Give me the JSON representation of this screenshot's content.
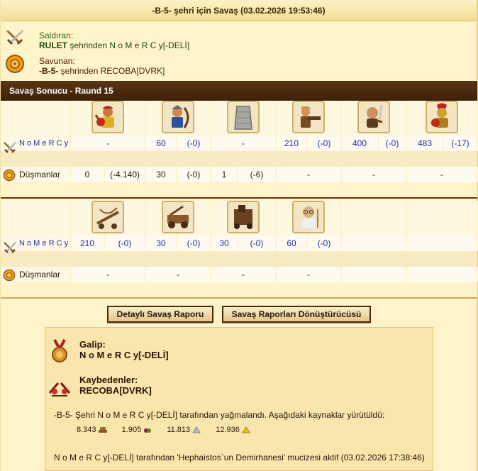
{
  "header": {
    "title": "-B-5- şehri için Savaş (03.02.2026 19:53:46)"
  },
  "attacker": {
    "role": "Saldıran:",
    "player": "RULET",
    "middle": " şehrinden ",
    "city": "N o M e R C y[-DELİ]"
  },
  "defender": {
    "role": "Savunan:",
    "city": "-B-5-",
    "middle": " şehrinden ",
    "player": "RECOBA[DVRK]"
  },
  "result_bar": {
    "title": "Savaş Sonucu - Raund 15"
  },
  "table1": {
    "attacker_label": "N o M e R C y",
    "enemy_label": "Düşmanlar",
    "units": [
      {
        "icon": "ram-unit-icon",
        "atk": "-",
        "atk_delta": "",
        "def": "0",
        "def_delta": "(-4.140)"
      },
      {
        "icon": "archer-unit-icon",
        "atk": "60",
        "atk_delta": "(-0)",
        "def": "30",
        "def_delta": "(-0)"
      },
      {
        "icon": "wall-unit-icon",
        "atk": "-",
        "atk_delta": "",
        "def": "1",
        "def_delta": "(-6)"
      },
      {
        "icon": "gunner-unit-icon",
        "atk": "210",
        "atk_delta": "(-0)",
        "def": "-",
        "def_delta": ""
      },
      {
        "icon": "swordsman-unit-icon",
        "atk": "400",
        "atk_delta": "(-0)",
        "def": "-",
        "def_delta": ""
      },
      {
        "icon": "spartan-unit-icon",
        "atk": "483",
        "atk_delta": "(-17)",
        "def": "-",
        "def_delta": ""
      }
    ]
  },
  "table2": {
    "attacker_label": "N o M e R C y",
    "enemy_label": "Düşmanlar",
    "units": [
      {
        "icon": "ballista-unit-icon",
        "atk": "210",
        "atk_delta": "(-0)",
        "def": "-",
        "def_delta": ""
      },
      {
        "icon": "catapult-unit-icon",
        "atk": "30",
        "atk_delta": "(-0)",
        "def": "-",
        "def_delta": ""
      },
      {
        "icon": "mortar-unit-icon",
        "atk": "30",
        "atk_delta": "(-0)",
        "def": "-",
        "def_delta": ""
      },
      {
        "icon": "doctor-unit-icon",
        "atk": "60",
        "atk_delta": "(-0)",
        "def": "-",
        "def_delta": ""
      }
    ]
  },
  "buttons": {
    "detailed": "Detaylı Savaş Raporu",
    "converter": "Savaş Raporları Dönüştürücüsü"
  },
  "summary": {
    "winner_heading": "Galip:",
    "winner_name": "N o M e R C y[-DELİ]",
    "loser_heading": "Kaybedenler:",
    "loser_name": "RECOBA[DVRK]",
    "plunder_text": "-B-5- Şehri N o M e R C y[-DELİ] tarafından yağmalandı. Aşağıdaki kaynaklar yürütüldü:",
    "resources": [
      {
        "amount": "8.343",
        "icon": "wood-icon"
      },
      {
        "amount": "1.905",
        "icon": "wine-icon"
      },
      {
        "amount": "11.813",
        "icon": "marble-icon"
      },
      {
        "amount": "12.936",
        "icon": "sulfur-icon"
      }
    ],
    "wonder_text": "N o M e R C y[-DELİ] tarafından 'Hephaistos`un Demirhanesi' mucizesi aktif (03.02.2026 17:38:46)"
  },
  "colors": {
    "background": "#fff3c9",
    "bar": "#4a2a0e",
    "attacker_text": "#1a2fb0",
    "attacker_label": "#2a6b12"
  }
}
